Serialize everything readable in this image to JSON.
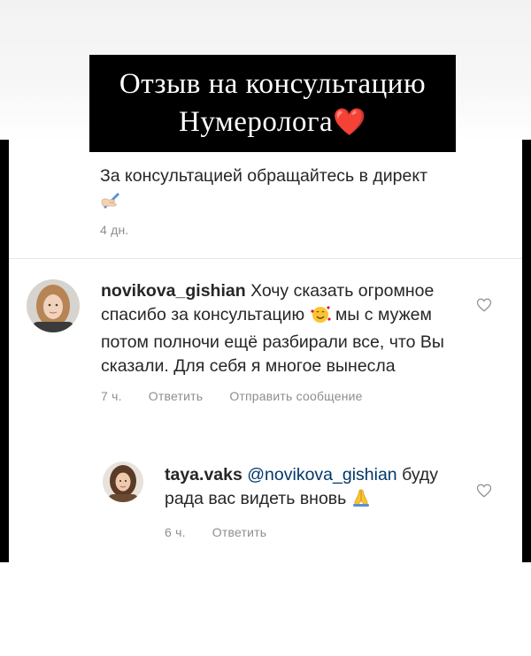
{
  "header": {
    "line1": "Отзыв на консультацию",
    "line2": "Нумеролога",
    "heart_emoji": "❤️"
  },
  "intro": {
    "text": "За консультацией обращайтесь в директ",
    "emoji": "writing-hand",
    "time": "4 дн."
  },
  "comments": [
    {
      "username": "novikova_gishian",
      "text_part1": "Хочу сказать огромное спасибо за консультацию",
      "emoji": "smiling-face-with-hearts",
      "text_part2": "мы с мужем потом полночи ещё разбирали все, что Вы сказали. Для себя я многое вынесла",
      "time": "7 ч.",
      "reply_label": "Ответить",
      "send_label": "Отправить сообщение"
    },
    {
      "username": "taya.vaks",
      "mention": "@novikova_gishian",
      "text": "буду рада вас видеть вновь",
      "emoji": "folded-hands",
      "time": "6 ч.",
      "reply_label": "Ответить"
    }
  ],
  "colors": {
    "background": "#ffffff",
    "side_bars": "#000000",
    "title_box": "#000000",
    "title_text": "#ffffff",
    "heart": "#e0112b",
    "text": "#262626",
    "meta_text": "#8e8e8e",
    "mention": "#00376b"
  }
}
